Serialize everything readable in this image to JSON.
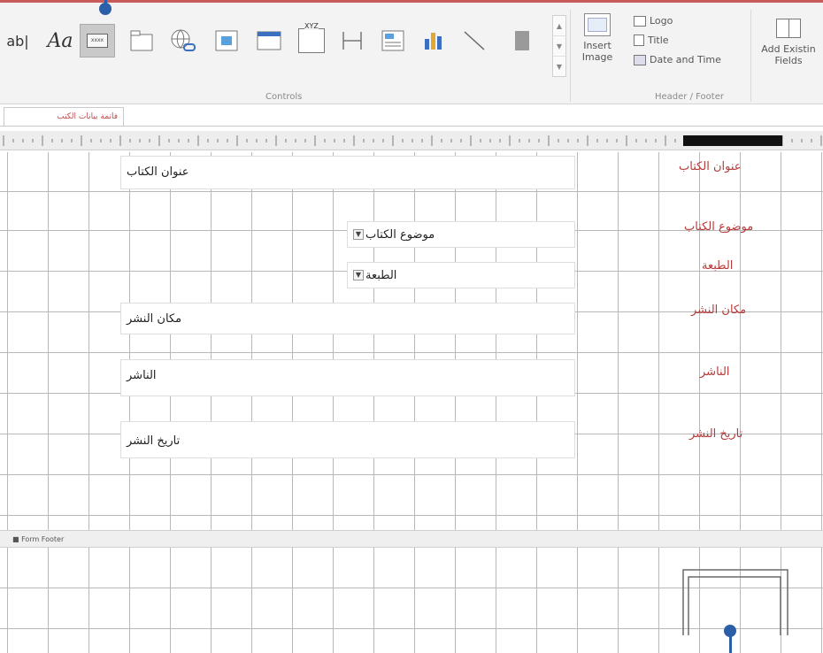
{
  "ribbon": {
    "controls": [
      {
        "name": "textbox-control-icon",
        "label": "ab|"
      },
      {
        "name": "label-control-icon",
        "label": "Aa"
      },
      {
        "name": "button-control-icon",
        "label": "xxxx"
      },
      {
        "name": "tab-control-icon",
        "label": ""
      },
      {
        "name": "hyperlink-control-icon",
        "label": ""
      },
      {
        "name": "web-browser-control-icon",
        "label": ""
      },
      {
        "name": "navigation-control-icon",
        "label": ""
      },
      {
        "name": "option-group-control-icon",
        "label": "XYZ"
      },
      {
        "name": "page-break-control-icon",
        "label": ""
      },
      {
        "name": "combo-box-control-icon",
        "label": ""
      },
      {
        "name": "chart-control-icon",
        "label": ""
      },
      {
        "name": "line-control-icon",
        "label": ""
      },
      {
        "name": "toggle-control-icon",
        "label": ""
      }
    ],
    "controls_group_label": "Controls",
    "insert_image_label_1": "Insert",
    "insert_image_label_2": "Image",
    "header_footer": {
      "logo": "Logo",
      "title": "Title",
      "date_time": "Date and Time",
      "group_label": "Header / Footer"
    },
    "add_existing_1": "Add Existin",
    "add_existing_2": "Fields"
  },
  "tab": {
    "label": "فاتمة بيانات الكتب"
  },
  "form": {
    "fields": [
      {
        "key": "book_title",
        "text": "عنوان الكتاب"
      },
      {
        "key": "book_subject",
        "text": "موضوع الكتاب"
      },
      {
        "key": "edition",
        "text": "الطبعة"
      },
      {
        "key": "pub_place",
        "text": "مكان النشر"
      },
      {
        "key": "publisher",
        "text": "الناشر"
      },
      {
        "key": "pub_date",
        "text": "تاريخ النشر"
      }
    ],
    "labels": [
      {
        "key": "book_title",
        "text": "عنوان الكتاب"
      },
      {
        "key": "book_subject",
        "text": "موضوع الكتاب"
      },
      {
        "key": "edition",
        "text": "الطبعة"
      },
      {
        "key": "pub_place",
        "text": "مكان النشر"
      },
      {
        "key": "publisher",
        "text": "الناشر"
      },
      {
        "key": "pub_date",
        "text": "تاريخ النشر"
      }
    ]
  },
  "footer": {
    "label": "Form Footer"
  },
  "colors": {
    "callout": "#2b5fa8",
    "label_text": "#b83a3a",
    "accent": "#c85a5a"
  }
}
